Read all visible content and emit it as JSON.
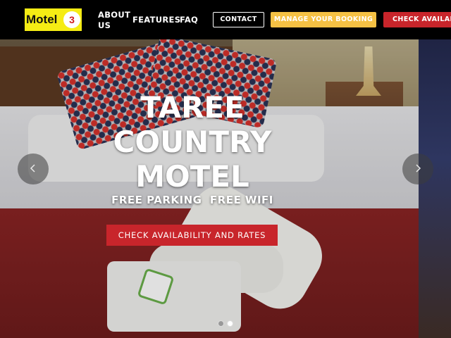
{
  "logo": {
    "text": "Motel",
    "badge": "3"
  },
  "nav": {
    "about": "ABOUT US",
    "features": "FEATURES",
    "faq": "FAQ"
  },
  "buttons": {
    "contact": "CONTACT",
    "manage_booking": "MANAGE YOUR BOOKING",
    "check_availability": "CHECK AVAILABILITY"
  },
  "hero": {
    "title_lines": [
      "TAREE",
      "COUNTRY",
      "MOTEL"
    ],
    "subtitle": "FREE PARKING  FREE WIFI",
    "cta": "CHECK AVAILABILITY AND RATES",
    "prev_icon": "chevron-left-icon",
    "next_icon": "chevron-right-icon",
    "slides": 2,
    "active_slide": 2
  },
  "colors": {
    "logo_bg": "#f5ec14",
    "logo_badge_text": "#d11a1a",
    "manage_btn": "#f5c144",
    "check_btn": "#c8252b",
    "header_bg": "#000000"
  }
}
